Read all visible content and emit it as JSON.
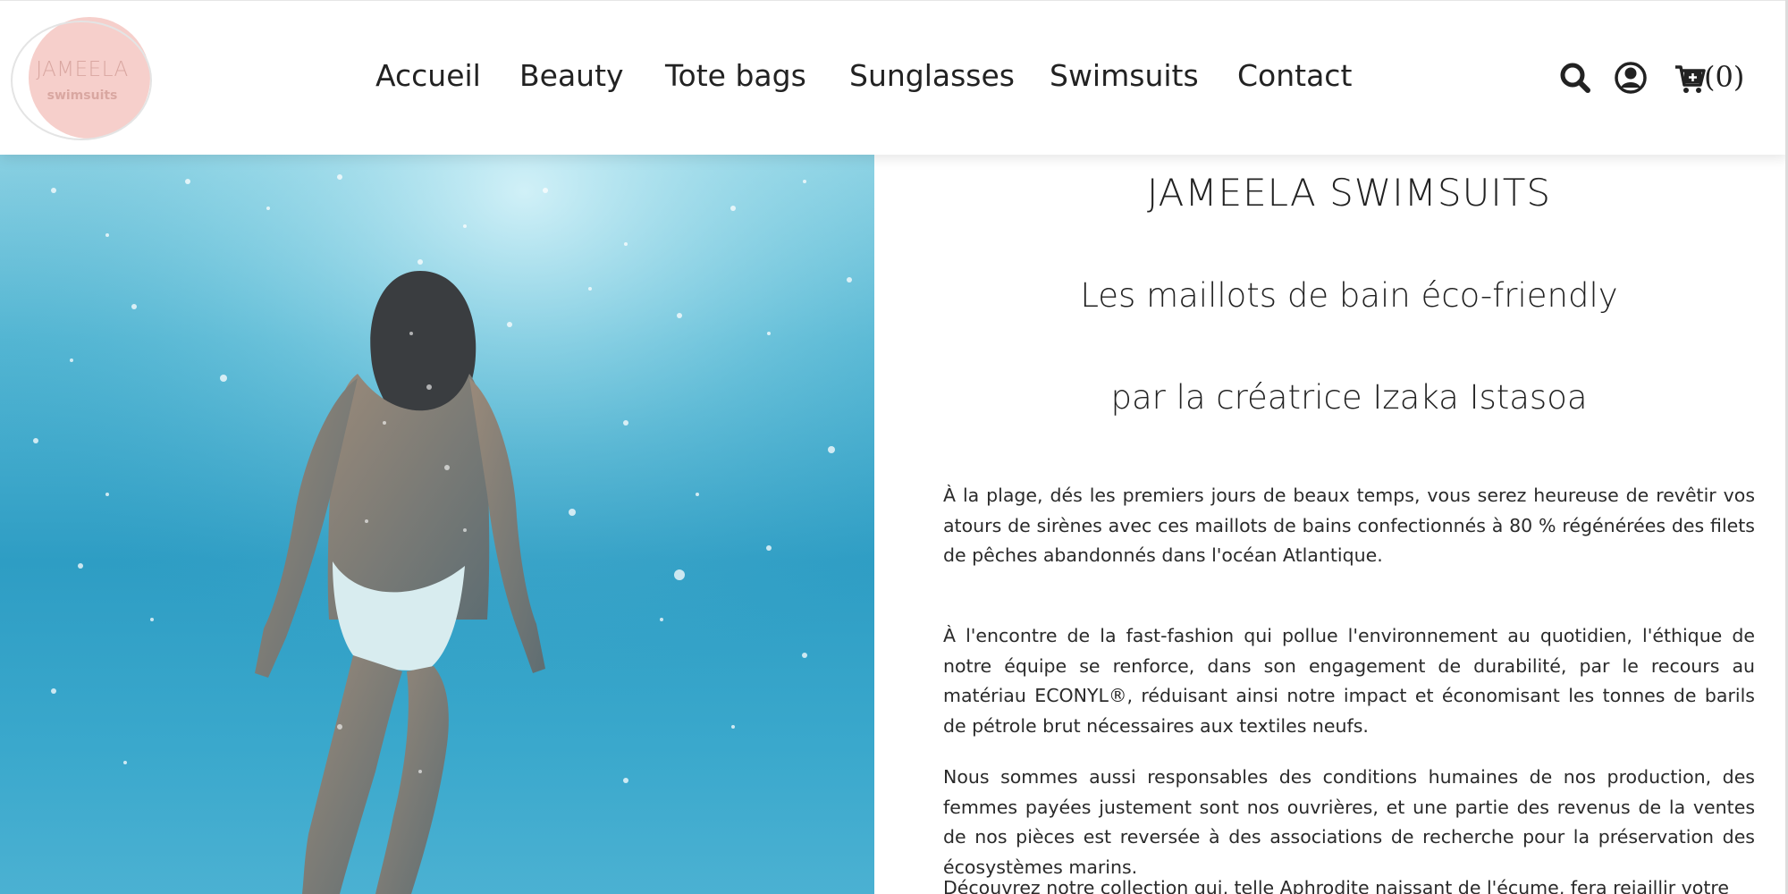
{
  "brand": {
    "logo_line1": "JAMEELA",
    "logo_line2": "swimsuits",
    "logo_color": "#f6cfcb",
    "logo_text_color": "#d9a7a1"
  },
  "nav": {
    "items": [
      {
        "label": "Accueil"
      },
      {
        "label": "Beauty"
      },
      {
        "label": "Tote bags"
      },
      {
        "label": "Sunglasses"
      },
      {
        "label": "Swimsuits"
      },
      {
        "label": "Contact"
      }
    ]
  },
  "header_icons": {
    "search": "search-icon",
    "account": "user-circle-icon",
    "cart": "cart-plus-icon",
    "cart_count": "(0)"
  },
  "hero": {
    "image": "underwater-swimmer-photo"
  },
  "content": {
    "title": "JAMEELA SWIMSUITS",
    "subtitle1": "Les maillots de bain éco-friendly",
    "subtitle2": "par la créatrice Izaka Istasoa",
    "paragraphs": [
      "À la plage, dés les premiers jours de beaux temps, vous serez heureuse de revêtir vos atours de sirènes avec ces maillots de bains confectionnés à 80 % régénérées des filets de pêches abandonnés dans l'océan Atlantique.",
      "À l'encontre de la fast-fashion qui pollue l'environnement au quotidien, l'éthique de notre équipe se renforce, dans son engagement de durabilité, par le recours au matériau ECONYL®, réduisant ainsi notre impact et économisant les tonnes de barils de pétrole brut nécessaires aux textiles neufs.",
      "Nous sommes aussi responsables des conditions humaines de nos production, des femmes payées justement sont nos ouvrières, et une partie des revenus de la ventes de nos pièces est reversée à des associations de recherche pour la préservation des écosystèmes marins.",
      "Découvrez notre collection qui, telle Aphrodite naissant de l'écume, fera rejaillir votre"
    ]
  },
  "colors": {
    "text": "#222222",
    "water_light": "#8fd3e4",
    "water_deep": "#2e9dc4"
  }
}
